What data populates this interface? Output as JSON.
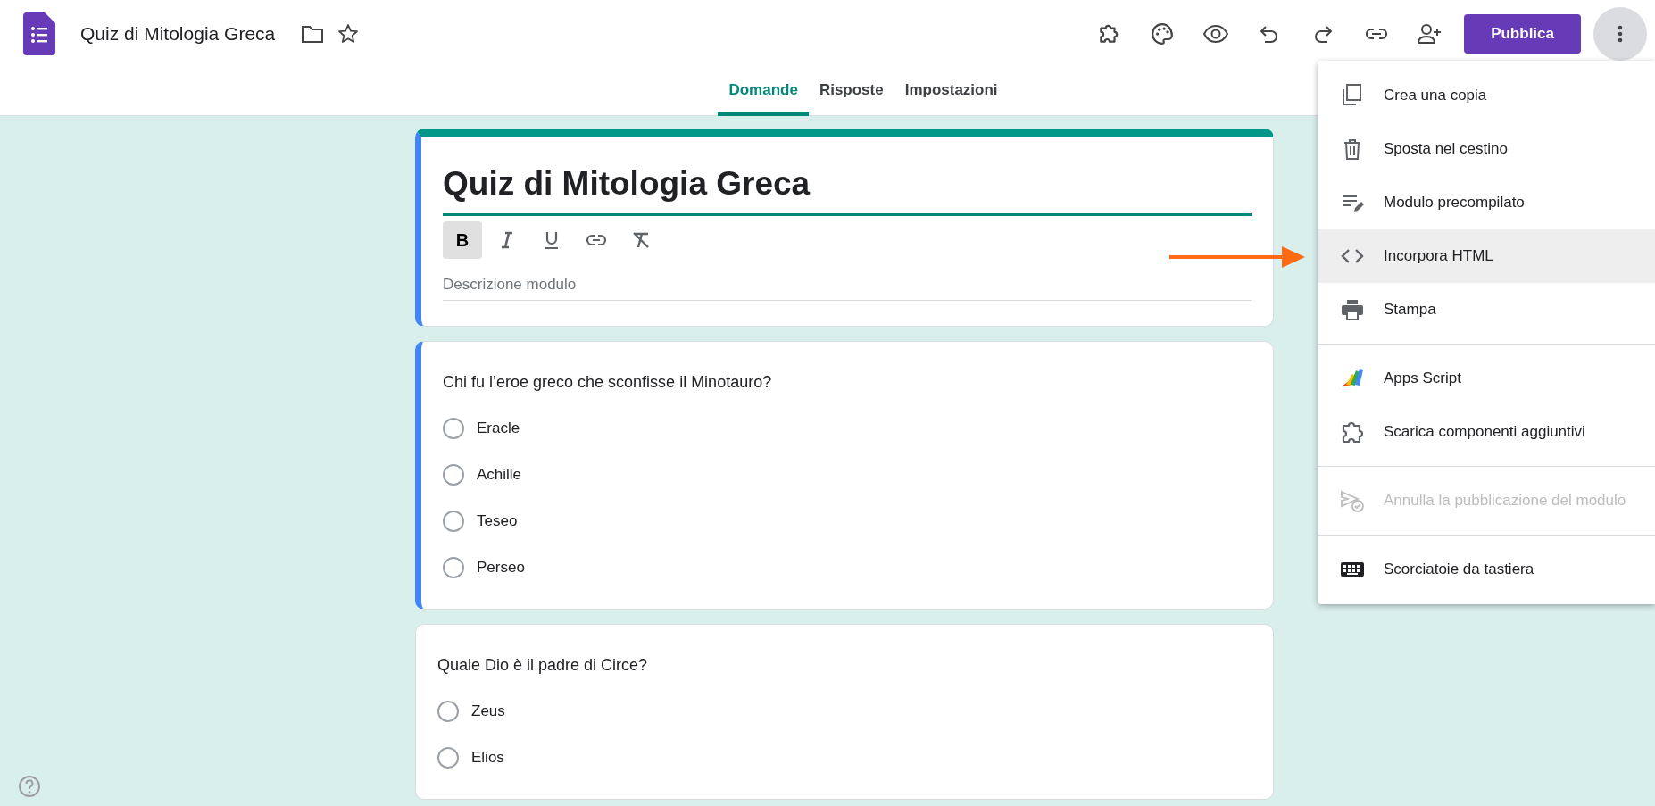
{
  "app": {
    "title": "Quiz di Mitologia Greca"
  },
  "toolbar": {
    "publish_button": "Pubblica"
  },
  "tabs": [
    {
      "label": "Domande",
      "selected": true
    },
    {
      "label": "Risposte",
      "selected": false
    },
    {
      "label": "Impostazioni",
      "selected": false
    }
  ],
  "form_header": {
    "title": "Quiz di Mitologia Greca",
    "focused": true,
    "description_placeholder": "Descrizione modulo",
    "format_buttons": [
      {
        "kind": "bold",
        "symbol": "B",
        "selected": true
      },
      {
        "kind": "italic",
        "selected": false
      },
      {
        "kind": "underline",
        "selected": false
      },
      {
        "kind": "link",
        "selected": false
      },
      {
        "kind": "clear",
        "selected": false
      }
    ]
  },
  "questions": [
    {
      "text": "Chi fu l’eroe greco che sconfisse il Minotauro?",
      "focused": true,
      "options": [
        {
          "label": "Eracle",
          "selected": false
        },
        {
          "label": "Achille",
          "selected": false
        },
        {
          "label": "Teseo",
          "selected": false
        },
        {
          "label": "Perseo",
          "selected": false
        }
      ]
    },
    {
      "text": "Quale Dio è il padre di Circe?",
      "focused": false,
      "options": [
        {
          "label": "Zeus",
          "selected": false
        },
        {
          "label": "Elios",
          "selected": false
        }
      ]
    }
  ],
  "menu": {
    "sections": [
      [
        {
          "kind": "copy",
          "label": "Crea una copia",
          "highlighted": false,
          "disabled": false
        },
        {
          "kind": "trash",
          "label": "Sposta nel cestino",
          "highlighted": false,
          "disabled": false
        },
        {
          "kind": "prefill",
          "label": "Modulo precompilato",
          "highlighted": false,
          "disabled": false
        },
        {
          "kind": "code",
          "label": "Incorpora HTML",
          "highlighted": true,
          "disabled": false
        },
        {
          "kind": "print",
          "label": "Stampa",
          "highlighted": false,
          "disabled": false
        }
      ],
      [
        {
          "kind": "script",
          "label": "Apps Script",
          "highlighted": false,
          "disabled": false
        },
        {
          "kind": "addon",
          "label": "Scarica componenti aggiuntivi",
          "highlighted": false,
          "disabled": false
        }
      ],
      [
        {
          "kind": "unpublish",
          "label": "Annulla la pubblicazione del modulo",
          "highlighted": false,
          "disabled": true
        }
      ],
      [
        {
          "kind": "keyboard",
          "label": "Scorciatoie da tastiera",
          "highlighted": false,
          "disabled": false
        }
      ]
    ]
  }
}
